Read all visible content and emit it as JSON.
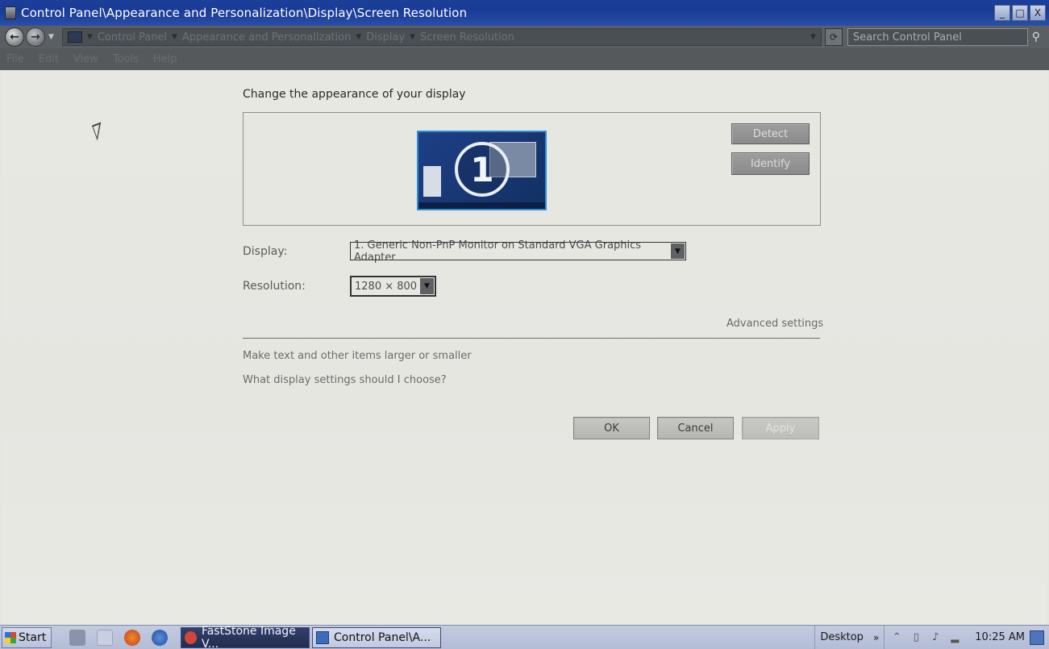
{
  "window": {
    "title": "Control Panel\\Appearance and Personalization\\Display\\Screen Resolution",
    "buttons": [
      "_",
      "□",
      "X"
    ]
  },
  "address_bar": {
    "breadcrumbs": [
      "Control Panel",
      "Appearance and Personalization",
      "Display",
      "Screen Resolution"
    ],
    "search_placeholder": "Search Control Panel"
  },
  "menu": [
    "File",
    "Edit",
    "View",
    "Tools",
    "Help"
  ],
  "main": {
    "heading": "Change the appearance of your display",
    "monitor_number": "1",
    "detect_label": "Detect",
    "identify_label": "Identify",
    "display_label": "Display:",
    "display_value": "1. Generic Non-PnP Monitor on Standard VGA Graphics Adapter",
    "resolution_label": "Resolution:",
    "resolution_value": "1280 × 800",
    "advanced_link": "Advanced settings",
    "link_text_size": "Make text and other items larger or smaller",
    "link_help": "What display settings should I choose?",
    "ok_label": "OK",
    "cancel_label": "Cancel",
    "apply_label": "Apply"
  },
  "taskbar": {
    "start_label": "Start",
    "tasks": [
      "FastStone Image V...",
      "Control Panel\\A..."
    ],
    "desktop_label": "Desktop",
    "time": "10:25 AM"
  },
  "colors": {
    "titlebar": "#1c3f9a",
    "content_bg": "#e6e6e1",
    "button_dark": "#8a8b8a"
  }
}
